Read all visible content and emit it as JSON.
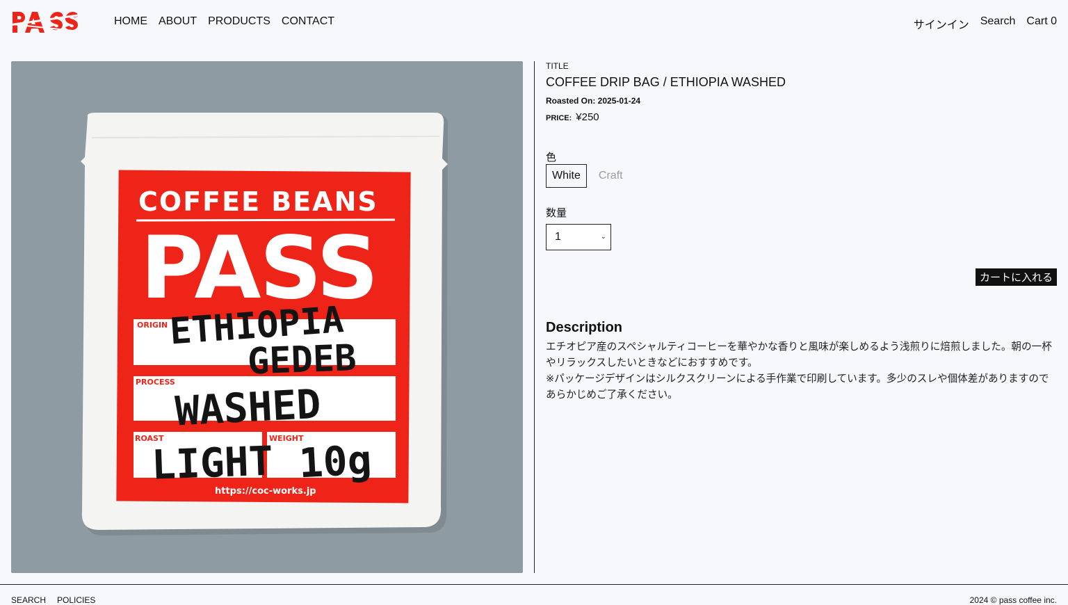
{
  "header": {
    "logo_text": "PASS",
    "nav": [
      "HOME",
      "ABOUT",
      "PRODUCTS",
      "CONTACT"
    ],
    "signin": "サインイン",
    "search": "Search",
    "cart": "Cart 0"
  },
  "image": {
    "bag_heading": "COFFEE BEANS",
    "bag_brand": "PASS",
    "origin_label": "ORIGIN",
    "origin_value_1": "ETHIOPIA",
    "origin_value_2": "GEDEB",
    "process_label": "PROCESS",
    "process_value": "WASHED",
    "roast_label": "ROAST",
    "roast_value": "LIGHT",
    "weight_label": "WEIGHT",
    "weight_value": "10g",
    "url": "https://coc-works.jp"
  },
  "product": {
    "title_label": "TITLE",
    "title": "COFFEE DRIP BAG / ETHIOPIA WASHED",
    "roasted": "Roasted On: 2025-01-24",
    "price_label": "PRICE:",
    "price": "¥250",
    "color_label": "色",
    "color_options": [
      "White",
      "Craft"
    ],
    "selected_color": "White",
    "qty_label": "数量",
    "qty_value": "1",
    "cart_button": "カートに入れる"
  },
  "description": {
    "heading": "Description",
    "line1": "エチオピア産のスペシャルティコーヒーを華やかな香りと風味が楽しめるよう浅煎りに焙煎しました。朝の一杯やリラックスしたいときなどにおすすめです。",
    "line2": "※パッケージデザインはシルクスクリーンによる手作業で印刷しています。多少のスレや個体差がありますのであらかじめご了承ください。"
  },
  "footer": {
    "links": [
      "SEARCH",
      "POLICIES"
    ],
    "copyright": "2024 © pass coffee inc."
  },
  "colors": {
    "accent_red": "#ee2418",
    "bg": "#f6f8fb",
    "photo_bg": "#8f9ba2"
  }
}
